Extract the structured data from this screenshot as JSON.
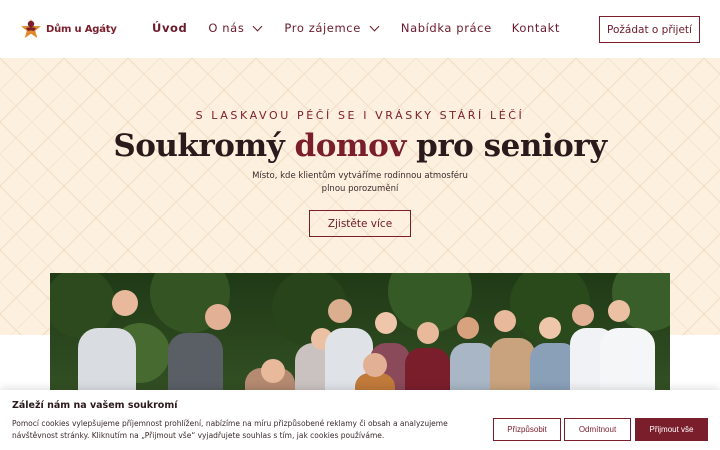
{
  "brand": {
    "name": "Dům u Agáty",
    "accent": "#7a1e2c",
    "logo_star": "#e0892b"
  },
  "nav": {
    "items": [
      {
        "label": "Úvod"
      },
      {
        "label": "O nás"
      },
      {
        "label": "Pro zájemce"
      },
      {
        "label": "Nabídka práce"
      },
      {
        "label": "Kontakt"
      }
    ],
    "cta_label": "Požádat o přijetí"
  },
  "hero": {
    "tagline": "S LASKAVOU PÉČÍ SE I VRÁSKY STÁŘÍ LÉČÍ",
    "title_before": "Soukromý ",
    "title_accent": "domov",
    "title_after": " pro seniory",
    "subtitle_line1": "Místo, kde klientům vytváříme rodinnou atmosféru",
    "subtitle_line2": "plnou porozumění",
    "button_label": "Zjistěte více",
    "background": "#fdf0df"
  },
  "cookie": {
    "title": "Záleží nám na vašem soukromí",
    "text": "Pomocí cookies vylepšujeme příjemnost prohlížení, nabízíme na míru přizpůsobené reklamy či obsah a analyzujeme návštěvnost stránky. Kliknutím na „Přijmout vše“ vyjadřujete souhlas s tím, jak cookies používáme.",
    "customize_label": "Přizpůsobit",
    "reject_label": "Odmítnout",
    "accept_label": "Přijmout vše"
  },
  "icons": {
    "logo": "star-person-icon",
    "dropdown": "chevron-down-icon"
  }
}
